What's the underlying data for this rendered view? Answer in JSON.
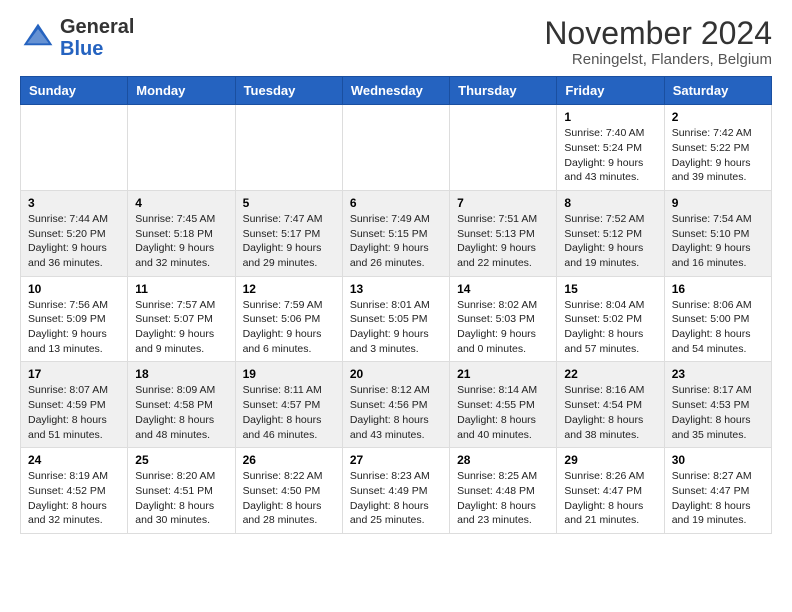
{
  "header": {
    "logo_general": "General",
    "logo_blue": "Blue",
    "month_title": "November 2024",
    "location": "Reningelst, Flanders, Belgium"
  },
  "weekdays": [
    "Sunday",
    "Monday",
    "Tuesday",
    "Wednesday",
    "Thursday",
    "Friday",
    "Saturday"
  ],
  "weeks": [
    [
      {
        "day": "",
        "info": ""
      },
      {
        "day": "",
        "info": ""
      },
      {
        "day": "",
        "info": ""
      },
      {
        "day": "",
        "info": ""
      },
      {
        "day": "",
        "info": ""
      },
      {
        "day": "1",
        "info": "Sunrise: 7:40 AM\nSunset: 5:24 PM\nDaylight: 9 hours and 43 minutes."
      },
      {
        "day": "2",
        "info": "Sunrise: 7:42 AM\nSunset: 5:22 PM\nDaylight: 9 hours and 39 minutes."
      }
    ],
    [
      {
        "day": "3",
        "info": "Sunrise: 7:44 AM\nSunset: 5:20 PM\nDaylight: 9 hours and 36 minutes."
      },
      {
        "day": "4",
        "info": "Sunrise: 7:45 AM\nSunset: 5:18 PM\nDaylight: 9 hours and 32 minutes."
      },
      {
        "day": "5",
        "info": "Sunrise: 7:47 AM\nSunset: 5:17 PM\nDaylight: 9 hours and 29 minutes."
      },
      {
        "day": "6",
        "info": "Sunrise: 7:49 AM\nSunset: 5:15 PM\nDaylight: 9 hours and 26 minutes."
      },
      {
        "day": "7",
        "info": "Sunrise: 7:51 AM\nSunset: 5:13 PM\nDaylight: 9 hours and 22 minutes."
      },
      {
        "day": "8",
        "info": "Sunrise: 7:52 AM\nSunset: 5:12 PM\nDaylight: 9 hours and 19 minutes."
      },
      {
        "day": "9",
        "info": "Sunrise: 7:54 AM\nSunset: 5:10 PM\nDaylight: 9 hours and 16 minutes."
      }
    ],
    [
      {
        "day": "10",
        "info": "Sunrise: 7:56 AM\nSunset: 5:09 PM\nDaylight: 9 hours and 13 minutes."
      },
      {
        "day": "11",
        "info": "Sunrise: 7:57 AM\nSunset: 5:07 PM\nDaylight: 9 hours and 9 minutes."
      },
      {
        "day": "12",
        "info": "Sunrise: 7:59 AM\nSunset: 5:06 PM\nDaylight: 9 hours and 6 minutes."
      },
      {
        "day": "13",
        "info": "Sunrise: 8:01 AM\nSunset: 5:05 PM\nDaylight: 9 hours and 3 minutes."
      },
      {
        "day": "14",
        "info": "Sunrise: 8:02 AM\nSunset: 5:03 PM\nDaylight: 9 hours and 0 minutes."
      },
      {
        "day": "15",
        "info": "Sunrise: 8:04 AM\nSunset: 5:02 PM\nDaylight: 8 hours and 57 minutes."
      },
      {
        "day": "16",
        "info": "Sunrise: 8:06 AM\nSunset: 5:00 PM\nDaylight: 8 hours and 54 minutes."
      }
    ],
    [
      {
        "day": "17",
        "info": "Sunrise: 8:07 AM\nSunset: 4:59 PM\nDaylight: 8 hours and 51 minutes."
      },
      {
        "day": "18",
        "info": "Sunrise: 8:09 AM\nSunset: 4:58 PM\nDaylight: 8 hours and 48 minutes."
      },
      {
        "day": "19",
        "info": "Sunrise: 8:11 AM\nSunset: 4:57 PM\nDaylight: 8 hours and 46 minutes."
      },
      {
        "day": "20",
        "info": "Sunrise: 8:12 AM\nSunset: 4:56 PM\nDaylight: 8 hours and 43 minutes."
      },
      {
        "day": "21",
        "info": "Sunrise: 8:14 AM\nSunset: 4:55 PM\nDaylight: 8 hours and 40 minutes."
      },
      {
        "day": "22",
        "info": "Sunrise: 8:16 AM\nSunset: 4:54 PM\nDaylight: 8 hours and 38 minutes."
      },
      {
        "day": "23",
        "info": "Sunrise: 8:17 AM\nSunset: 4:53 PM\nDaylight: 8 hours and 35 minutes."
      }
    ],
    [
      {
        "day": "24",
        "info": "Sunrise: 8:19 AM\nSunset: 4:52 PM\nDaylight: 8 hours and 32 minutes."
      },
      {
        "day": "25",
        "info": "Sunrise: 8:20 AM\nSunset: 4:51 PM\nDaylight: 8 hours and 30 minutes."
      },
      {
        "day": "26",
        "info": "Sunrise: 8:22 AM\nSunset: 4:50 PM\nDaylight: 8 hours and 28 minutes."
      },
      {
        "day": "27",
        "info": "Sunrise: 8:23 AM\nSunset: 4:49 PM\nDaylight: 8 hours and 25 minutes."
      },
      {
        "day": "28",
        "info": "Sunrise: 8:25 AM\nSunset: 4:48 PM\nDaylight: 8 hours and 23 minutes."
      },
      {
        "day": "29",
        "info": "Sunrise: 8:26 AM\nSunset: 4:47 PM\nDaylight: 8 hours and 21 minutes."
      },
      {
        "day": "30",
        "info": "Sunrise: 8:27 AM\nSunset: 4:47 PM\nDaylight: 8 hours and 19 minutes."
      }
    ]
  ]
}
